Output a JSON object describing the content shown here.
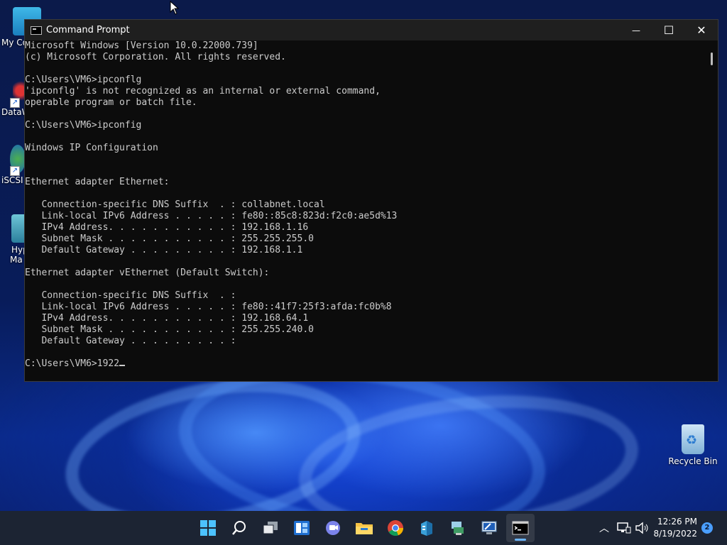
{
  "desktop": {
    "icons": [
      {
        "label": "My Co"
      },
      {
        "label": "DataW"
      },
      {
        "label": "iSCSI"
      },
      {
        "label": "Hyp"
      },
      {
        "label": "Ma"
      }
    ],
    "recycle_bin": {
      "label": "Recycle Bin"
    }
  },
  "window": {
    "title": "Command Prompt",
    "minimize_glyph": "—",
    "maximize_glyph": "☐",
    "close_glyph": "✕"
  },
  "console": {
    "lines": [
      "Microsoft Windows [Version 10.0.22000.739]",
      "(c) Microsoft Corporation. All rights reserved.",
      "",
      "C:\\Users\\VM6>ipconflg",
      "'ipconflg' is not recognized as an internal or external command,",
      "operable program or batch file.",
      "",
      "C:\\Users\\VM6>ipconfig",
      "",
      "Windows IP Configuration",
      "",
      "",
      "Ethernet adapter Ethernet:",
      "",
      "   Connection-specific DNS Suffix  . : collabnet.local",
      "   Link-local IPv6 Address . . . . . : fe80::85c8:823d:f2c0:ae5d%13",
      "   IPv4 Address. . . . . . . . . . . : 192.168.1.16",
      "   Subnet Mask . . . . . . . . . . . : 255.255.255.0",
      "   Default Gateway . . . . . . . . . : 192.168.1.1",
      "",
      "Ethernet adapter vEthernet (Default Switch):",
      "",
      "   Connection-specific DNS Suffix  . :",
      "   Link-local IPv6 Address . . . . . : fe80::41f7:25f3:afda:fc0b%8",
      "   IPv4 Address. . . . . . . . . . . : 192.168.64.1",
      "   Subnet Mask . . . . . . . . . . . : 255.255.240.0",
      "   Default Gateway . . . . . . . . . :",
      ""
    ],
    "prompt": "C:\\Users\\VM6>1922"
  },
  "taskbar": {
    "icons": [
      "windows-start",
      "search",
      "task-view",
      "widgets",
      "teams-chat",
      "file-explorer",
      "chrome",
      "server-app",
      "network-app",
      "remote-app",
      "command-prompt"
    ],
    "clock_time": "12:26 PM",
    "clock_date": "8/19/2022",
    "notification_count": "2"
  },
  "colors": {
    "console_bg": "#0c0c0c",
    "console_text": "#cccccc",
    "taskbar_bg": "#1c2433",
    "accent": "#4a9eff"
  }
}
